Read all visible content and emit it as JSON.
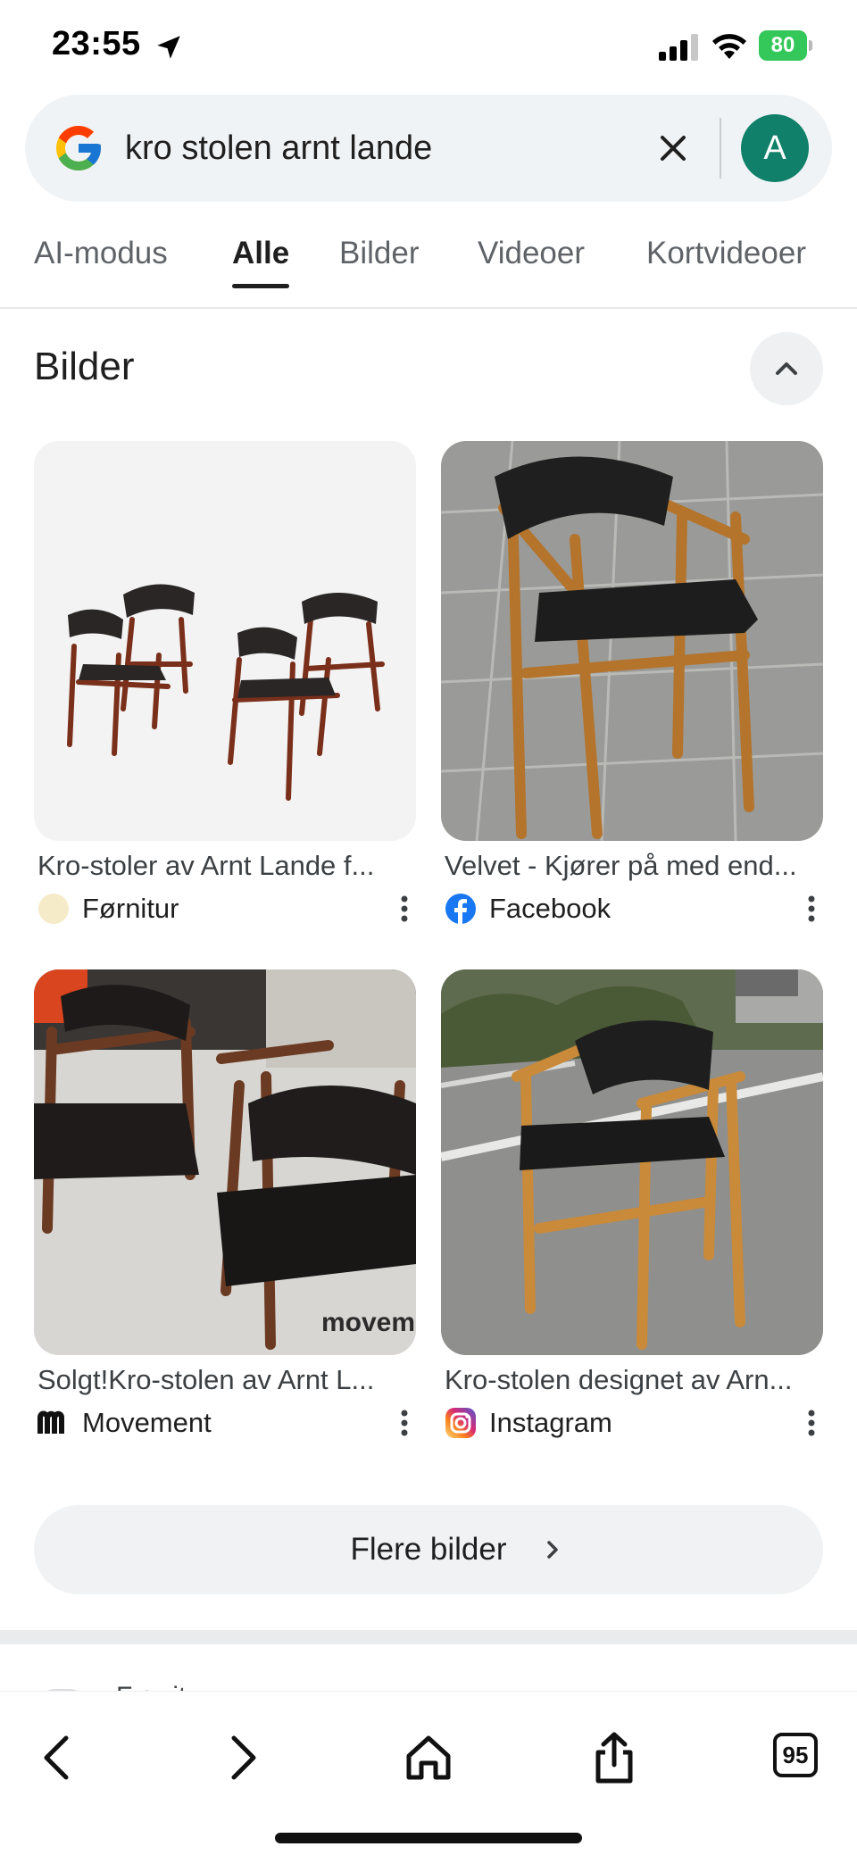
{
  "status_bar": {
    "time": "23:55",
    "battery": "80",
    "icons": [
      "location-arrow-icon",
      "cellular-signal-icon",
      "wifi-icon",
      "battery-icon"
    ]
  },
  "search": {
    "query": "kro stolen arnt lande",
    "avatar_initial": "A",
    "avatar_color": "#10806a"
  },
  "tabs": [
    {
      "label": "AI-modus",
      "active": false
    },
    {
      "label": "Alle",
      "active": true
    },
    {
      "label": "Bilder",
      "active": false
    },
    {
      "label": "Videoer",
      "active": false
    },
    {
      "label": "Kortvideoer",
      "active": false
    }
  ],
  "images_section": {
    "title": "Bilder",
    "results": [
      {
        "title": "Kro-stoler av Arnt Lande f...",
        "source": "Førnitur",
        "source_icon": "fornitur-logo-icon"
      },
      {
        "title": "Velvet - Kjører på med end...",
        "source": "Facebook",
        "source_icon": "facebook-logo-icon"
      },
      {
        "title": "Solgt!Kro-stolen av Arnt L...",
        "source": "Movement",
        "source_icon": "movement-logo-icon"
      },
      {
        "title": "Kro-stolen designet av Arn...",
        "source": "Instagram",
        "source_icon": "instagram-logo-icon"
      }
    ],
    "thumbnail_watermark": "movem",
    "more_button": "Flere bilder"
  },
  "next_result_peek": "Førnitur",
  "toolbar": {
    "tab_count": "95",
    "icons": [
      "back-icon",
      "forward-icon",
      "home-icon",
      "share-icon",
      "tabs-icon"
    ]
  },
  "colors": {
    "accent": "#1f1f1f",
    "search_bg": "#f0f3f6",
    "battery": "#34c759"
  }
}
